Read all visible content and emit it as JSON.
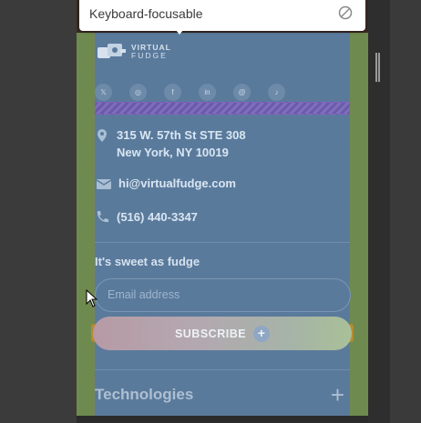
{
  "tooltip": {
    "text": "Keyboard-focusable",
    "icon": "no-entry-icon"
  },
  "logo": {
    "line1": "VIRTUAL",
    "line2": "FUDGE"
  },
  "socials": [
    {
      "glyph": "𝕏",
      "icon": "x-icon"
    },
    {
      "glyph": "◎",
      "icon": "instagram-icon"
    },
    {
      "glyph": "f",
      "icon": "facebook-icon"
    },
    {
      "glyph": "in",
      "icon": "linkedin-icon"
    },
    {
      "glyph": "@",
      "icon": "threads-icon"
    },
    {
      "glyph": "♪",
      "icon": "tiktok-icon"
    }
  ],
  "contact": {
    "address_line1": "315 W. 57th St STE 308",
    "address_line2": "New York, NY 10019",
    "email": "hi@virtualfudge.com",
    "phone": "(516) 440-3347"
  },
  "newsletter": {
    "tagline": "It's sweet as fudge",
    "email_placeholder": "Email address",
    "subscribe_label": "SUBSCRIBE",
    "subscribe_icon": "+"
  },
  "accordion": {
    "title": "Technologies",
    "toggle": "+"
  },
  "colors": {
    "content_overlay": "#5a7a9c",
    "padding_overlay": "#6f8a4e",
    "outline": "#8a5cc8"
  }
}
